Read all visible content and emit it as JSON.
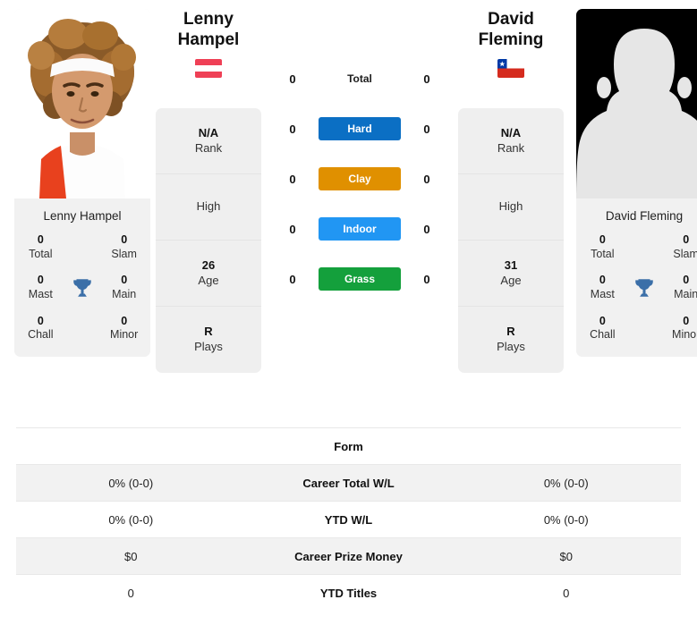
{
  "players": {
    "left": {
      "name_header": "Lenny Hampel",
      "name_header_line1": "Lenny",
      "name_header_line2": "Hampel",
      "flag": "austria-flag",
      "photo": "player-photo",
      "card_name": "Lenny Hampel",
      "titles": [
        {
          "value": "0",
          "label": "Total"
        },
        {
          "value": "0",
          "label": "Slam"
        },
        {
          "value": "0",
          "label": "Mast"
        },
        {
          "value": "0",
          "label": "Main"
        },
        {
          "value": "0",
          "label": "Chall"
        },
        {
          "value": "0",
          "label": "Minor"
        }
      ],
      "info": [
        {
          "value": "N/A",
          "label": "Rank"
        },
        {
          "value": "",
          "label": "High"
        },
        {
          "value": "26",
          "label": "Age"
        },
        {
          "value": "R",
          "label": "Plays"
        }
      ]
    },
    "right": {
      "name_header": "David Fleming",
      "name_header_line1": "David",
      "name_header_line2": "Fleming",
      "flag": "chile-flag",
      "photo": "player-photo-placeholder",
      "card_name": "David Fleming",
      "titles": [
        {
          "value": "0",
          "label": "Total"
        },
        {
          "value": "0",
          "label": "Slam"
        },
        {
          "value": "0",
          "label": "Mast"
        },
        {
          "value": "0",
          "label": "Main"
        },
        {
          "value": "0",
          "label": "Chall"
        },
        {
          "value": "0",
          "label": "Minor"
        }
      ],
      "info": [
        {
          "value": "N/A",
          "label": "Rank"
        },
        {
          "value": "",
          "label": "High"
        },
        {
          "value": "31",
          "label": "Age"
        },
        {
          "value": "R",
          "label": "Plays"
        }
      ]
    }
  },
  "head_to_head": [
    {
      "label": "Total",
      "left": "0",
      "right": "0",
      "style": "plain",
      "color": ""
    },
    {
      "label": "Hard",
      "left": "0",
      "right": "0",
      "style": "badge",
      "color": "#0b6fc4"
    },
    {
      "label": "Clay",
      "left": "0",
      "right": "0",
      "style": "badge",
      "color": "#e09000"
    },
    {
      "label": "Indoor",
      "left": "0",
      "right": "0",
      "style": "badge",
      "color": "#2196f3"
    },
    {
      "label": "Grass",
      "left": "0",
      "right": "0",
      "style": "badge",
      "color": "#14a03c"
    }
  ],
  "stats_table": [
    {
      "label": "Form",
      "left": "",
      "right": "",
      "shaded": false
    },
    {
      "label": "Career Total W/L",
      "left": "0% (0-0)",
      "right": "0% (0-0)",
      "shaded": true
    },
    {
      "label": "YTD W/L",
      "left": "0% (0-0)",
      "right": "0% (0-0)",
      "shaded": false
    },
    {
      "label": "Career Prize Money",
      "left": "$0",
      "right": "$0",
      "shaded": true
    },
    {
      "label": "YTD Titles",
      "left": "0",
      "right": "0",
      "shaded": false
    }
  ],
  "colors": {
    "hard": "#0b6fc4",
    "clay": "#e09000",
    "indoor": "#2196f3",
    "grass": "#14a03c",
    "trophy": "#3b6fa8",
    "card_bg": "#f1f1f1",
    "row_shade": "#f2f2f2"
  }
}
